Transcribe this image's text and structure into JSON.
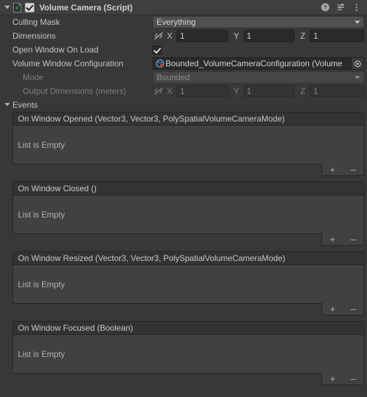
{
  "component": {
    "title": "Volume Camera (Script)",
    "script_icon": "script-icon",
    "enabled": true,
    "foldout_expanded": true,
    "header_icons": [
      {
        "name": "help-icon",
        "glyph": "?"
      },
      {
        "name": "preset-icon",
        "glyph": "preset"
      },
      {
        "name": "more-menu-icon",
        "glyph": "⋮"
      }
    ]
  },
  "fields": {
    "culling_mask": {
      "label": "Culling Mask",
      "value": "Everything"
    },
    "dimensions": {
      "label": "Dimensions",
      "link_icon": "unlinked-icon",
      "axes": [
        {
          "axis": "X",
          "value": "1"
        },
        {
          "axis": "Y",
          "value": "1"
        },
        {
          "axis": "Z",
          "value": "1"
        }
      ]
    },
    "open_window_on_load": {
      "label": "Open Window On Load",
      "checked": true
    },
    "volume_window_configuration": {
      "label": "Volume Window Configuration",
      "value": "Bounded_VolumeCameraConfiguration (Volume",
      "object_icon": "scriptable-object-icon",
      "picker_icon": "object-picker-icon"
    },
    "mode": {
      "label": "Mode",
      "value": "Bounded",
      "disabled": true
    },
    "output_dimensions": {
      "label": "Output Dimensions (meters)",
      "link_icon": "unlinked-icon",
      "disabled": true,
      "axes": [
        {
          "axis": "X",
          "value": "1"
        },
        {
          "axis": "Y",
          "value": "1"
        },
        {
          "axis": "Z",
          "value": "1"
        }
      ]
    }
  },
  "events_section": {
    "label": "Events",
    "expanded": true,
    "empty_text": "List is Empty",
    "add_label": "+",
    "remove_label": "–",
    "events": [
      {
        "title": "On Window Opened (Vector3, Vector3, PolySpatialVolumeCameraMode)"
      },
      {
        "title": "On Window Closed ()"
      },
      {
        "title": "On Window Resized (Vector3, Vector3, PolySpatialVolumeCameraMode)"
      },
      {
        "title": "On Window Focused (Boolean)"
      }
    ]
  },
  "colors": {
    "background": "#383838",
    "header": "#3f3f3f",
    "field_bg": "#2a2a2a",
    "dropdown_bg": "#505050",
    "event_box": "#414141",
    "event_title": "#333333",
    "text": "#c4c4c4",
    "text_disabled": "#7e7e7e"
  }
}
